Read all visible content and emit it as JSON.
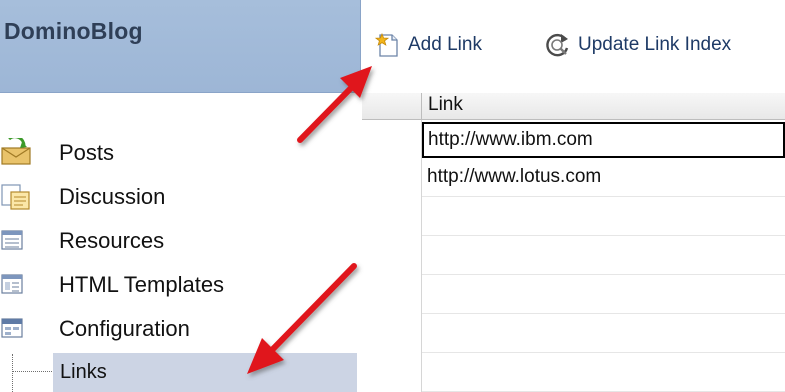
{
  "nav": {
    "title": "DominoBlog",
    "items": [
      {
        "label": "Posts",
        "icon": "posts-icon"
      },
      {
        "label": "Discussion",
        "icon": "discussion-icon"
      },
      {
        "label": "Resources",
        "icon": "resources-icon"
      },
      {
        "label": "HTML Templates",
        "icon": "html-templates-icon"
      },
      {
        "label": "Configuration",
        "icon": "configuration-icon"
      }
    ],
    "subitem": {
      "label": "Links"
    }
  },
  "toolbar": {
    "add_link": "Add Link",
    "update_link_index": "Update Link Index"
  },
  "view": {
    "column_header": "Link",
    "rows": [
      "http://www.ibm.com",
      "http://www.lotus.com",
      "",
      "",
      "",
      "",
      ""
    ]
  },
  "colors": {
    "nav_header_bg": "#a6bedb",
    "nav_title": "#2f3f57",
    "selected_subitem_bg": "#ccd4e4",
    "toolbar_text": "#1e3a66",
    "annotation_arrow": "#e0141c"
  }
}
